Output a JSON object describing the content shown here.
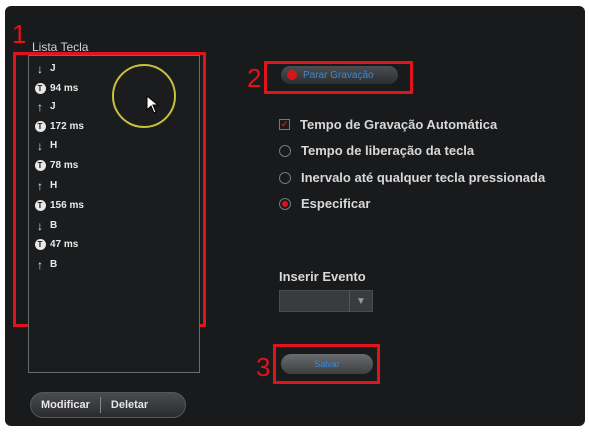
{
  "callouts": [
    "1",
    "2",
    "3"
  ],
  "key_list": {
    "label": "Lista Tecla",
    "events": [
      {
        "type": "down",
        "icon": "arrow-down-icon",
        "text": "J"
      },
      {
        "type": "delay",
        "icon": "timer-icon",
        "text": "94 ms"
      },
      {
        "type": "up",
        "icon": "arrow-up-icon",
        "text": "J"
      },
      {
        "type": "delay",
        "icon": "timer-icon",
        "text": "172 ms"
      },
      {
        "type": "down",
        "icon": "arrow-down-icon",
        "text": "H"
      },
      {
        "type": "delay",
        "icon": "timer-icon",
        "text": "78 ms"
      },
      {
        "type": "up",
        "icon": "arrow-up-icon",
        "text": "H"
      },
      {
        "type": "delay",
        "icon": "timer-icon",
        "text": "156 ms"
      },
      {
        "type": "down",
        "icon": "arrow-down-icon",
        "text": "B"
      },
      {
        "type": "delay",
        "icon": "timer-icon",
        "text": "47 ms"
      },
      {
        "type": "up",
        "icon": "arrow-up-icon",
        "text": "B"
      }
    ]
  },
  "buttons": {
    "modify": "Modificar",
    "delete": "Deletar",
    "stop_recording": "Parar Gravação",
    "save": "Salvar"
  },
  "options": {
    "auto_record": "Tempo de Gravação Automática",
    "key_release": "Tempo de liberação da tecla",
    "interval": "Inervalo até qualquer tecla pressionada",
    "specify": "Especificar"
  },
  "insert_event": {
    "label": "Inserir Evento",
    "value": ""
  },
  "colors": {
    "accent_red": "#d4161b",
    "callout_red": "#e0141a",
    "link_blue": "#3a8ad6",
    "background": "#191a1c"
  }
}
